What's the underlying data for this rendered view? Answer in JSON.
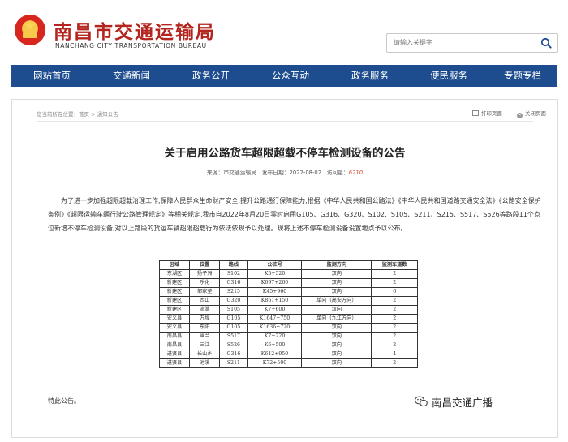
{
  "header": {
    "site_name": "南昌市交通运输局",
    "site_name_en": "NANCHANG CITY TRANSPORTATION BUREAU",
    "search_placeholder": "请输入关键字"
  },
  "nav": {
    "items": [
      {
        "label": "网站首页"
      },
      {
        "label": "交通新闻"
      },
      {
        "label": "政务公开"
      },
      {
        "label": "公众互动"
      },
      {
        "label": "政务服务"
      },
      {
        "label": "便民服务"
      },
      {
        "label": "专题专栏"
      }
    ]
  },
  "breadcrumb": "您当前所在位置：首页 > 通知公告",
  "tools": {
    "print": "打印页面",
    "close": "关闭页面"
  },
  "article": {
    "title": "关于启用公路货车超限超载不停车检测设备的公告",
    "source_label": "来源：",
    "source": "市交通运输局",
    "date_label": "发布日期：",
    "date": "2022-08-02",
    "views_label": "访问量：",
    "views": "6210",
    "paragraph": "为了进一步加强超限超载治理工作,保障人民群众生命财产安全,提升公路通行保障能力,根据《中华人民共和国公路法》《中华人民共和国道路交通安全法》《公路安全保护条例》《超限运输车辆行驶公路管理规定》等相关规定,我市自2022年8月20日零时启用G105、G316、G320、S102、S105、S211、S215、S517、S526等路段11个点位新增不停车检测设备,对以上路段的货运车辆超限超载行为依法依规予以处理。现将上述不停车检测设备设置地点予以公布。",
    "closing": "特此公告。"
  },
  "table": {
    "headers": [
      "区域",
      "位置",
      "路线",
      "公桩号",
      "监测方向",
      "监测车道数"
    ],
    "rows": [
      [
        "东湖区",
        "扬子洲",
        "S102",
        "K5+520",
        "双向",
        "2"
      ],
      [
        "新建区",
        "乐化",
        "G316",
        "K697+260",
        "双向",
        "2"
      ],
      [
        "新建区",
        "邹家垄",
        "S215",
        "K45+960",
        "双向",
        "6"
      ],
      [
        "新建区",
        "西山",
        "G320",
        "K861+150",
        "单向（高安方向）",
        "2"
      ],
      [
        "新建区",
        "流湖",
        "S105",
        "K7+600",
        "双向",
        "2"
      ],
      [
        "安义县",
        "万埠",
        "G105",
        "K1647+750",
        "单向（九江方向）",
        "2"
      ],
      [
        "安义县",
        "东阳",
        "G105",
        "K1636+720",
        "双向",
        "2"
      ],
      [
        "南昌县",
        "幽兰",
        "S517",
        "K7+220",
        "双向",
        "2"
      ],
      [
        "南昌县",
        "三江",
        "S526",
        "K6+500",
        "双向",
        "2"
      ],
      [
        "进贤县",
        "长山乡",
        "G316",
        "K612+950",
        "双向",
        "4"
      ],
      [
        "进贤县",
        "池溪",
        "S211",
        "K72+500",
        "双向",
        "2"
      ]
    ]
  },
  "watermark": "南昌交通广播"
}
